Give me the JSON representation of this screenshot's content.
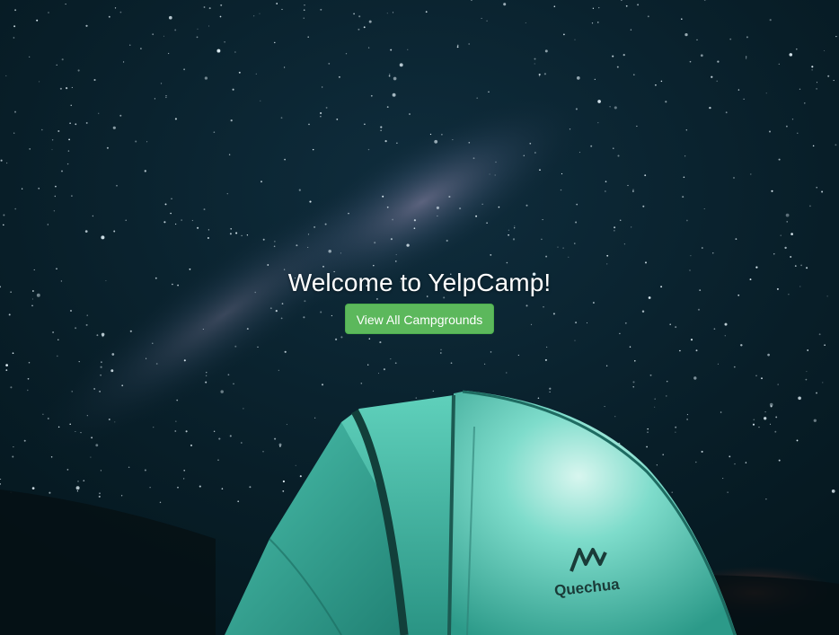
{
  "hero": {
    "title": "Welcome to YelpCamp!",
    "button_label": "View All Campgrounds"
  },
  "tent_logo_text": "Quechua",
  "colors": {
    "button_background": "#5cb85c",
    "button_border": "#4cae4c",
    "sky_dark": "#03161b",
    "tent_teal": "#3fb5a2"
  },
  "icons": [
    "starry-night-background",
    "tent-image",
    "quechua-logo"
  ]
}
